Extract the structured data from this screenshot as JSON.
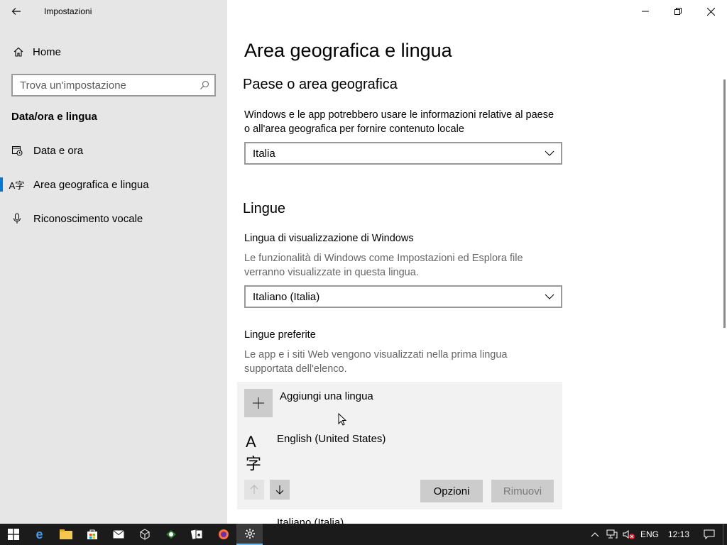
{
  "window": {
    "title": "Impostazioni",
    "back_icon": "arrow-left-icon",
    "controls": [
      "minimize",
      "restore",
      "close"
    ]
  },
  "sidebar": {
    "home_label": "Home",
    "search_placeholder": "Trova un'impostazione",
    "section_title": "Data/ora e lingua",
    "items": [
      {
        "label": "Data e ora",
        "icon": "calendar-clock-icon"
      },
      {
        "label": "Area geografica e lingua",
        "icon": "language-icon",
        "active": true
      },
      {
        "label": "Riconoscimento vocale",
        "icon": "microphone-icon"
      }
    ]
  },
  "main": {
    "title": "Area geografica e lingua",
    "region": {
      "heading": "Paese o area geografica",
      "description": "Windows e le app potrebbero usare le informazioni relative al paese o all'area geografica per fornire contenuto locale",
      "selected": "Italia"
    },
    "languages": {
      "heading": "Lingue",
      "display_label": "Lingua di visualizzazione di Windows",
      "display_description": "Le funzionalità di Windows come Impostazioni ed Esplora file verranno visualizzate in questa lingua.",
      "display_selected": "Italiano (Italia)",
      "preferred_label": "Lingue preferite",
      "preferred_description": "Le app e i siti Web vengono visualizzati nella prima lingua supportata dell'elenco.",
      "add_label": "Aggiungi una lingua",
      "list": [
        "English (United States)",
        "Italiano (Italia)"
      ],
      "options_button": "Opzioni",
      "remove_button": "Rimuovi"
    }
  },
  "taskbar": {
    "language": "ENG",
    "time": "12:13",
    "accent": "#76b9ed"
  }
}
